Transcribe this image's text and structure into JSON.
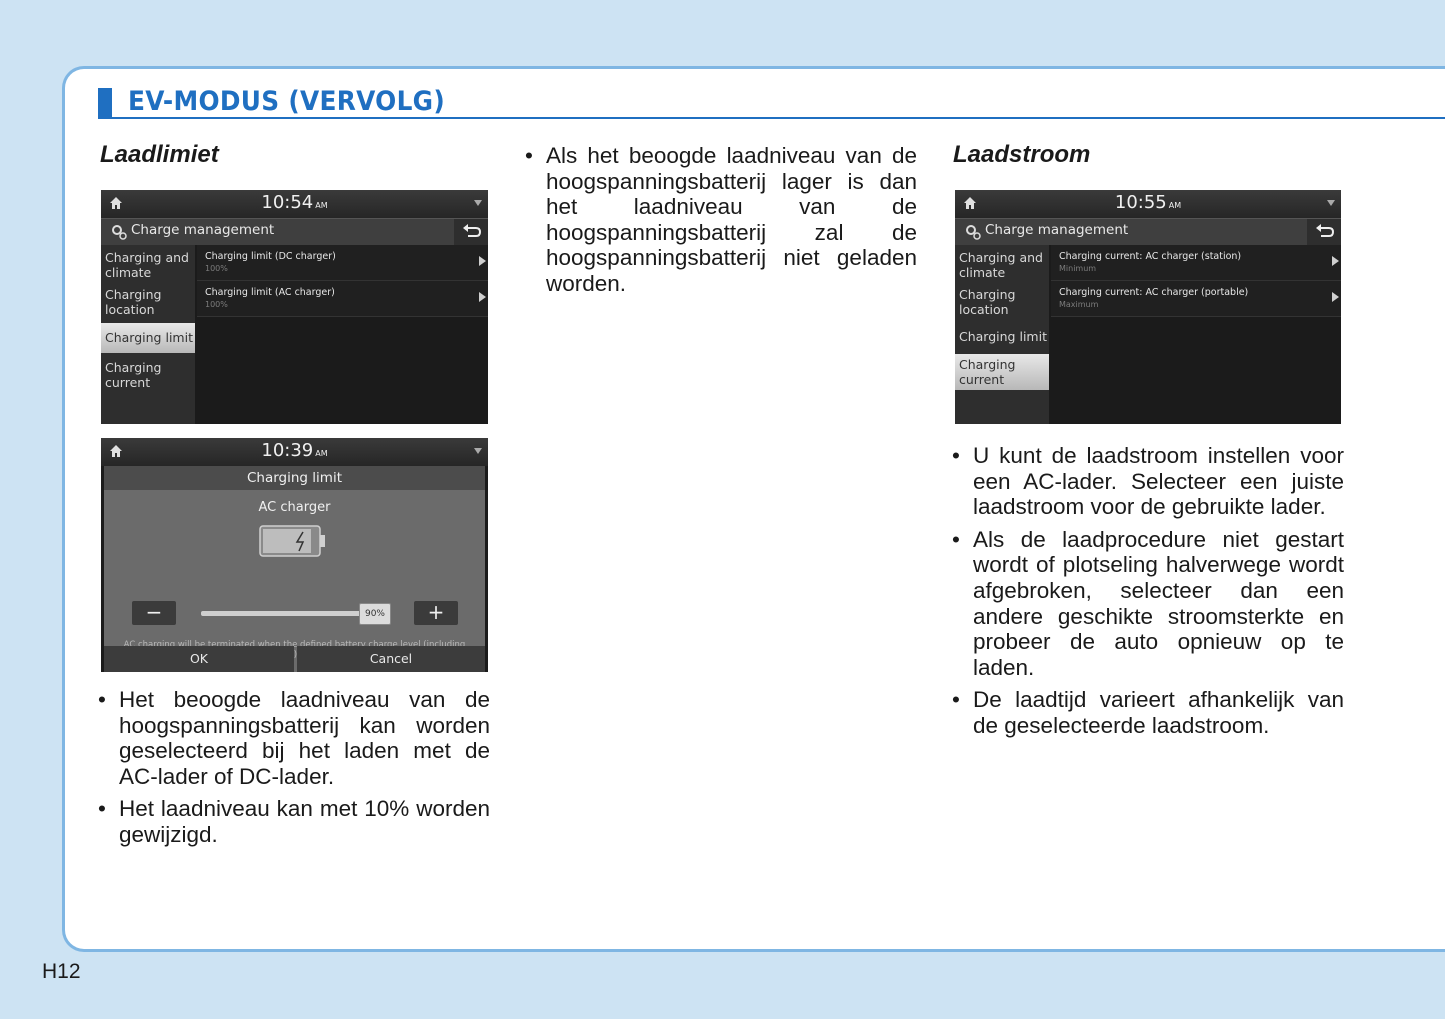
{
  "header": {
    "title": "EV-MODUS (VERVOLG)"
  },
  "left": {
    "heading": "Laadlimiet",
    "screen1": {
      "time": "10:54",
      "ampm": "AM",
      "bar_title": "Charge management",
      "menu": [
        "Charging and climate",
        "Charging location",
        "Charging limit",
        "Charging current"
      ],
      "rows": [
        {
          "title": "Charging limit (DC charger)",
          "value": "100%"
        },
        {
          "title": "Charging limit (AC charger)",
          "value": "100%"
        }
      ]
    },
    "screen2": {
      "time": "10:39",
      "ampm": "AM",
      "title": "Charging limit",
      "subtitle": "AC charger",
      "level": "90%",
      "minus": "−",
      "plus": "+",
      "note": "AC charging will be terminated when the defined battery charge level (including scheduled charging) has been reached.",
      "ok": "OK",
      "cancel": "Cancel"
    },
    "bullets": [
      "Het beoogde laadniveau van de hoogspanningsbatterij kan worden geselecteerd bij het laden met de AC-lader of DC-lader.",
      "Het laadniveau kan met 10% worden gewijzigd."
    ]
  },
  "middle": {
    "bullets": [
      "Als het beoogde laadniveau van de hoogspanningsbatterij lager is dan het laadniveau van de hoogspanningsbatterij zal de hoogspanningsbatterij niet geladen worden."
    ]
  },
  "right": {
    "heading": "Laadstroom",
    "screen": {
      "time": "10:55",
      "ampm": "AM",
      "bar_title": "Charge management",
      "menu": [
        "Charging and climate",
        "Charging location",
        "Charging limit",
        "Charging current"
      ],
      "rows": [
        {
          "title": "Charging current: AC charger (station)",
          "value": "Minimum"
        },
        {
          "title": "Charging current: AC charger (portable)",
          "value": "Maximum"
        }
      ]
    },
    "bullets": [
      "U kunt de laadstroom instellen voor een AC-lader. Selecteer een juiste laadstroom voor de gebruikte lader.",
      "Als de laadprocedure niet gestart wordt of plotseling halverwege wordt afgebroken, selecteer dan een andere geschikte stroomsterkte en probeer de auto opnieuw op te laden.",
      "De laadtijd varieert afhankelijk van de geselecteerde laadstroom."
    ]
  },
  "footer": {
    "page": "H12"
  }
}
